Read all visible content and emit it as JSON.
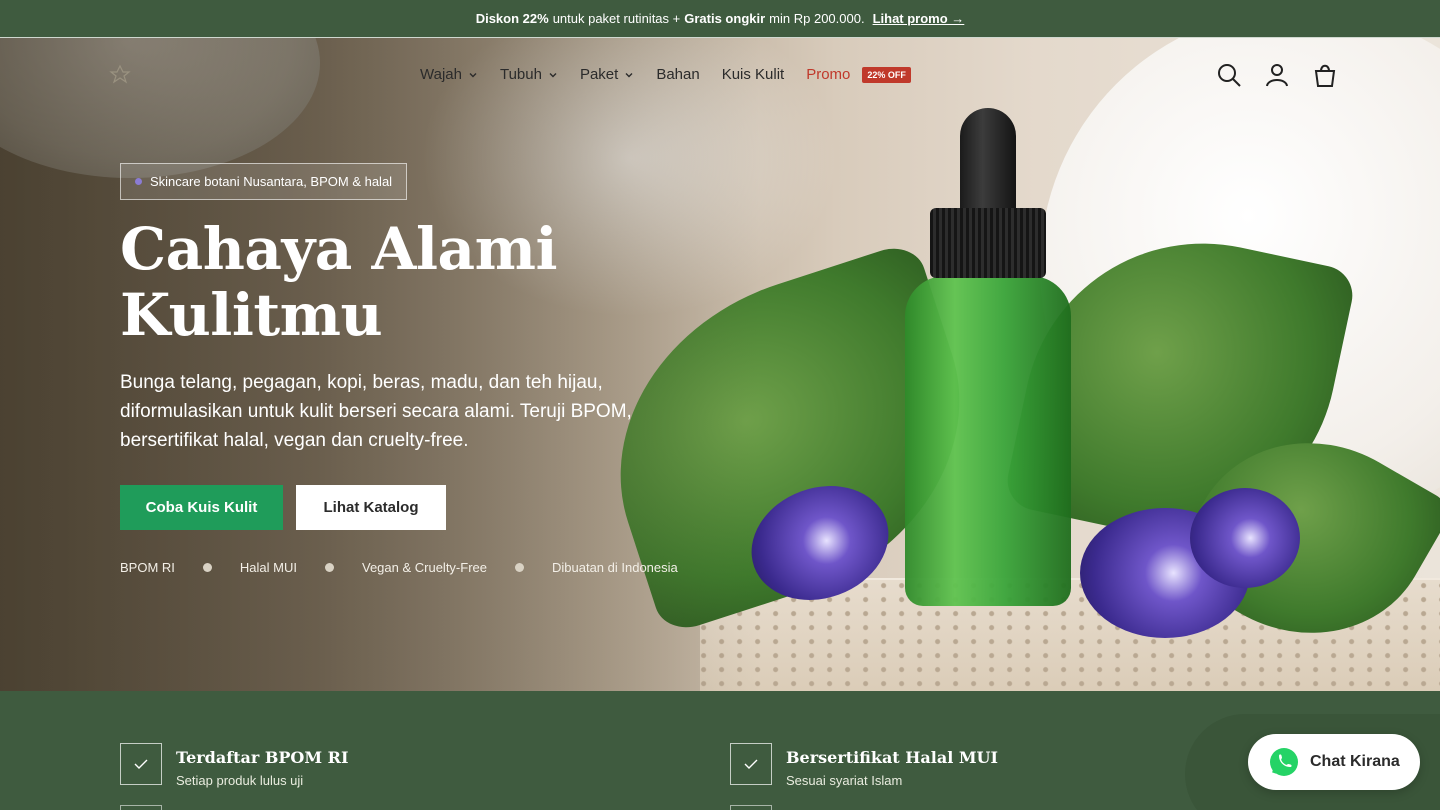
{
  "announcement": {
    "discount": "Diskon 22%",
    "text": "untuk paket rutinitas +",
    "shipping": "Gratis ongkir",
    "min_text": "min Rp 200.000.",
    "link": "Lihat promo →"
  },
  "nav": {
    "items": [
      {
        "label": "Wajah",
        "dropdown": true
      },
      {
        "label": "Tubuh",
        "dropdown": true
      },
      {
        "label": "Paket",
        "dropdown": true
      },
      {
        "label": "Bahan",
        "dropdown": false
      },
      {
        "label": "Kuis Kulit",
        "dropdown": false
      }
    ],
    "promo": {
      "label": "Promo",
      "badge": "22% OFF"
    },
    "icons": [
      "search-icon",
      "account-icon",
      "cart-icon"
    ]
  },
  "hero": {
    "pill": "Skincare botani Nusantara, BPOM & halal",
    "headline_line1": "Cahaya Alami",
    "headline_line2": "Kulitmu",
    "subcopy": "Bunga telang, pegagan, kopi, beras, madu, dan teh hijau, diformulasikan untuk kulit berseri secara alami. Teruji BPOM, bersertifikat halal, vegan dan cruelty-free.",
    "cta_primary": "Coba Kuis Kulit",
    "cta_secondary": "Lihat Katalog",
    "trust": [
      "BPOM RI",
      "Halal MUI",
      "Vegan & Cruelty-Free",
      "Dibuatan di Indonesia"
    ]
  },
  "features": [
    {
      "title": "Terdaftar BPOM RI",
      "subtitle": "Setiap produk lulus uji"
    },
    {
      "title": "Bersertifikat Halal MUI",
      "subtitle": "Sesuai syariat Islam"
    }
  ],
  "chat": {
    "label": "Chat Kirana"
  },
  "colors": {
    "brand_green": "#3f5b3f",
    "cta_green": "#1f9c5a",
    "promo_red": "#c0392b"
  }
}
